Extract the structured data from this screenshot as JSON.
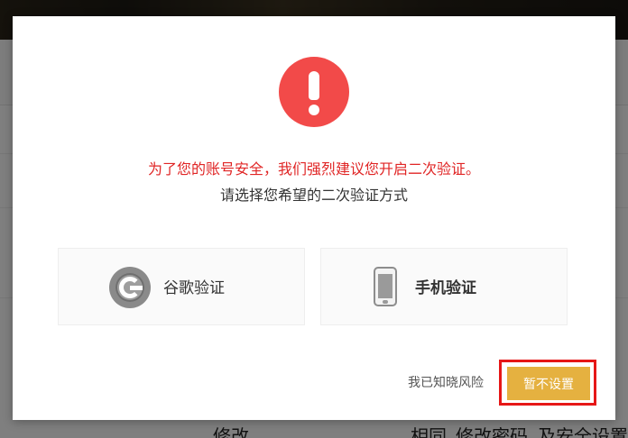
{
  "background": {
    "banner_text": "",
    "bottom_texts": [
      "修改",
      "相同",
      "修改密码",
      "及安全设置和"
    ]
  },
  "modal": {
    "warning": "为了您的账号安全，我们强烈建议您开启二次验证。",
    "subtitle": "请选择您希望的二次验证方式",
    "options": [
      {
        "label": "谷歌验证",
        "icon": "google-authenticator-icon"
      },
      {
        "label": "手机验证",
        "icon": "mobile-phone-icon"
      }
    ],
    "know_risk_label": "我已知晓风险",
    "skip_label": "暂不设置"
  },
  "colors": {
    "alert_red": "#f24a49",
    "warning_text": "#e02525",
    "button_gold": "#e5b140",
    "highlight_border": "#e61717"
  }
}
